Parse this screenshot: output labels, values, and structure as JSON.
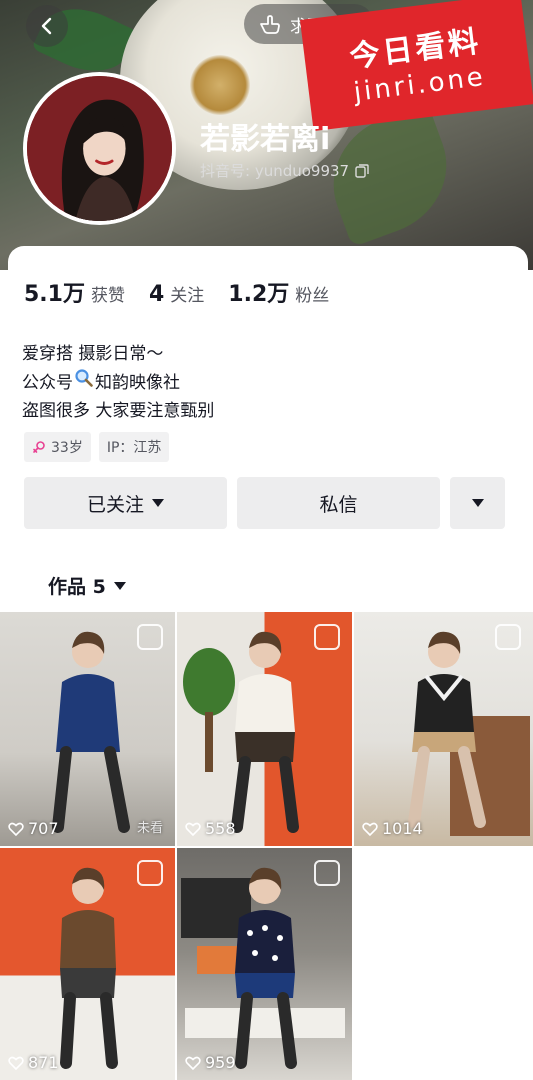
{
  "header": {
    "search_label": "求更新",
    "watermark_title": "今日看料",
    "watermark_url": "jinri.one",
    "nickname": "若影若离i",
    "douyin_id": "抖音号: yunduo9937"
  },
  "stats": [
    {
      "value": "5.1万",
      "label": "获赞"
    },
    {
      "value": "4",
      "label": "关注"
    },
    {
      "value": "1.2万",
      "label": "粉丝"
    }
  ],
  "bio": {
    "line1": "爱穿搭 摄影日常～",
    "line2_prefix": "公众号",
    "line2_suffix": "知韵映像社",
    "line3": "盗图很多 大家要注意甄别"
  },
  "tags": {
    "age": "33岁",
    "ip": "IP：江苏"
  },
  "actions": {
    "follow": "已关注",
    "message": "私信"
  },
  "works_tab": "作品 5",
  "colors": {
    "accent_red": "#e0262b",
    "gender_pink": "#e84393",
    "text_primary": "#161823",
    "button_bg": "#ededee"
  },
  "videos": [
    {
      "likes": "707",
      "unseen": "未看",
      "outfit": "#1f3a78",
      "bg": "#d9d7d2"
    },
    {
      "likes": "558",
      "unseen": "",
      "outfit": "#f4f1ea",
      "bg": "#e2562c"
    },
    {
      "likes": "1014",
      "unseen": "",
      "outfit": "#222222",
      "bg": "#e8e6e1"
    },
    {
      "likes": "871",
      "unseen": "",
      "outfit": "#6b4a2e",
      "bg": "#e4572e"
    },
    {
      "likes": "959",
      "unseen": "",
      "outfit": "#1a1f3c",
      "bg": "#bfbcb6"
    }
  ]
}
